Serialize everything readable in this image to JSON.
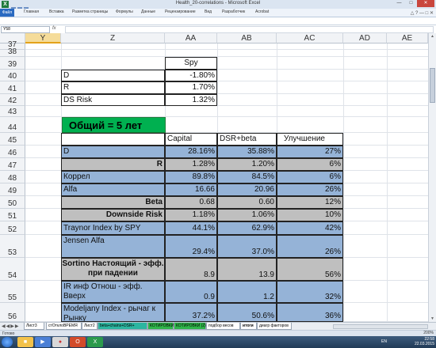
{
  "window": {
    "title": "Health_20-correlations - Microsoft Excel"
  },
  "ribbon": {
    "file": "Файл",
    "tabs": [
      "Главная",
      "Вставка",
      "Разметка страницы",
      "Формулы",
      "Данные",
      "Рецензирование",
      "Вид",
      "Разработчик",
      "Acrobat"
    ]
  },
  "formula_bar": {
    "name_box": "Y58",
    "fx": "fx",
    "formula": ""
  },
  "columns": [
    "Y",
    "Z",
    "AA",
    "AB",
    "AC",
    "AD",
    "AE"
  ],
  "selected_column": "Y",
  "rows": [
    "37",
    "38",
    "39",
    "40",
    "41",
    "42",
    "43",
    "44",
    "45",
    "46",
    "47",
    "48",
    "49",
    "50",
    "51",
    "52",
    "53",
    "54",
    "55",
    "56"
  ],
  "spy_table": {
    "header": "Spy",
    "rows": [
      {
        "label": "D",
        "value": "-1.80%"
      },
      {
        "label": "R",
        "value": "1.70%"
      },
      {
        "label": "DS Risk",
        "value": "1.32%"
      }
    ]
  },
  "section_title": "Общий = 5 лет",
  "main_table": {
    "headers": [
      "Capital",
      "DSR+beta",
      "Улучшение"
    ],
    "rows": [
      {
        "label": "D",
        "v1": "28.16%",
        "v2": "35.88%",
        "v3": "27%",
        "style": "blue",
        "align": "left",
        "bold": false
      },
      {
        "label": "R",
        "v1": "1.28%",
        "v2": "1.20%",
        "v3": "6%",
        "style": "gray",
        "align": "right",
        "bold": true
      },
      {
        "label": "Коррел",
        "v1": "89.8%",
        "v2": "84.5%",
        "v3": "6%",
        "style": "blue",
        "align": "left",
        "bold": false
      },
      {
        "label": "Alfa",
        "v1": "16.66",
        "v2": "20.96",
        "v3": "26%",
        "style": "blue",
        "align": "left",
        "bold": false
      },
      {
        "label": "Beta",
        "v1": "0.68",
        "v2": "0.60",
        "v3": "12%",
        "style": "gray",
        "align": "right",
        "bold": true
      },
      {
        "label": "Downside Risk",
        "v1": "1.18%",
        "v2": "1.06%",
        "v3": "10%",
        "style": "gray",
        "align": "right",
        "bold": true
      },
      {
        "label": "Traynor Index by SPY",
        "v1": "44.1%",
        "v2": "62.9%",
        "v3": "42%",
        "style": "blue",
        "align": "left",
        "bold": false
      },
      {
        "label": "Jensen Alfa",
        "v1": "29.4%",
        "v2": "37.0%",
        "v3": "26%",
        "style": "blue",
        "align": "left",
        "bold": false
      },
      {
        "label": "Sortino Настоящий - эфф. при падении",
        "v1": "8.9",
        "v2": "13.9",
        "v3": "56%",
        "style": "gray",
        "align": "center",
        "bold": true
      },
      {
        "label": "IR инф Отнош - эфф. Вверх",
        "v1": "0.9",
        "v2": "1.2",
        "v3": "32%",
        "style": "blue",
        "align": "left",
        "bold": false
      },
      {
        "label": "Modeljany Index - рычаг к Рынку",
        "v1": "37.2%",
        "v2": "50.6%",
        "v3": "36%",
        "style": "blue",
        "align": "left",
        "bold": false
      }
    ]
  },
  "sheet_tabs": [
    {
      "label": "Лист3",
      "kind": "normal"
    },
    {
      "label": "стОтклоВРЕМЯ",
      "kind": "normal"
    },
    {
      "label": "Лист2",
      "kind": "normal"
    },
    {
      "label": "beta+chains+DSR+",
      "kind": "teal"
    },
    {
      "label": "КОТИРОВКИ",
      "kind": "green"
    },
    {
      "label": "КОТИРОВКИ (2)",
      "kind": "green"
    },
    {
      "label": "подбор весов",
      "kind": "normal"
    },
    {
      "label": "итоги",
      "kind": "active"
    },
    {
      "label": "диагр факторов",
      "kind": "normal"
    }
  ],
  "status": {
    "ready": "Готово",
    "zoom": "200%"
  },
  "taskbar": {
    "lang": "EN",
    "time": "22:58",
    "date": "22.03.2015"
  },
  "colors": {
    "blue": "#95b3d7",
    "gray": "#bfbfbf",
    "green": "#00b050",
    "selected_header": "#f5dc9a"
  }
}
